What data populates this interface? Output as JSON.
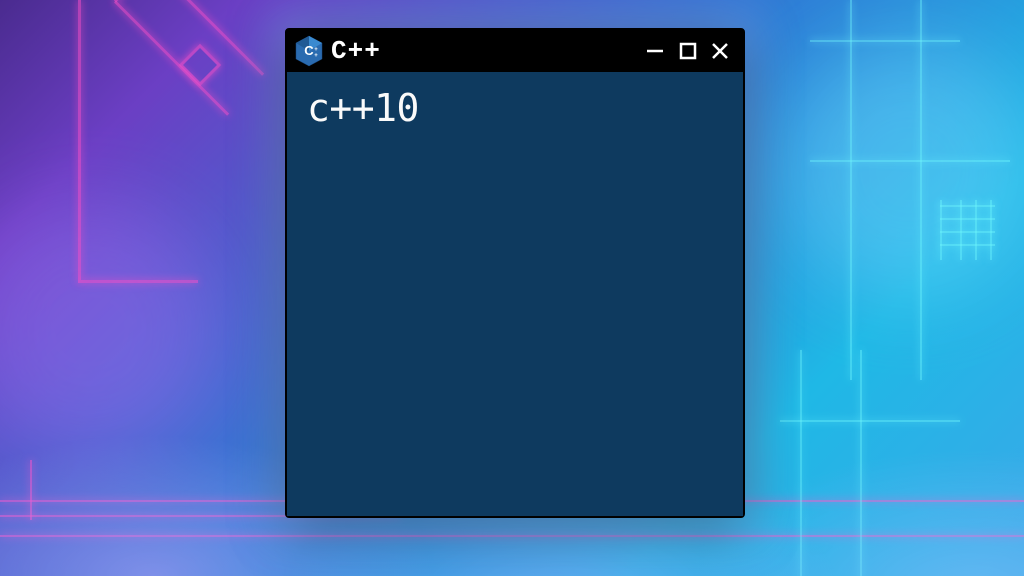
{
  "titlebar": {
    "title": "C++",
    "icon_name": "cpp-logo-icon"
  },
  "window_controls": {
    "minimize_name": "minimize-icon",
    "maximize_name": "maximize-icon",
    "close_name": "close-icon"
  },
  "content": {
    "text": "c++10"
  },
  "colors": {
    "titlebar_bg": "#000000",
    "content_bg": "#0e3a5f",
    "text_color": "#fafafa"
  }
}
